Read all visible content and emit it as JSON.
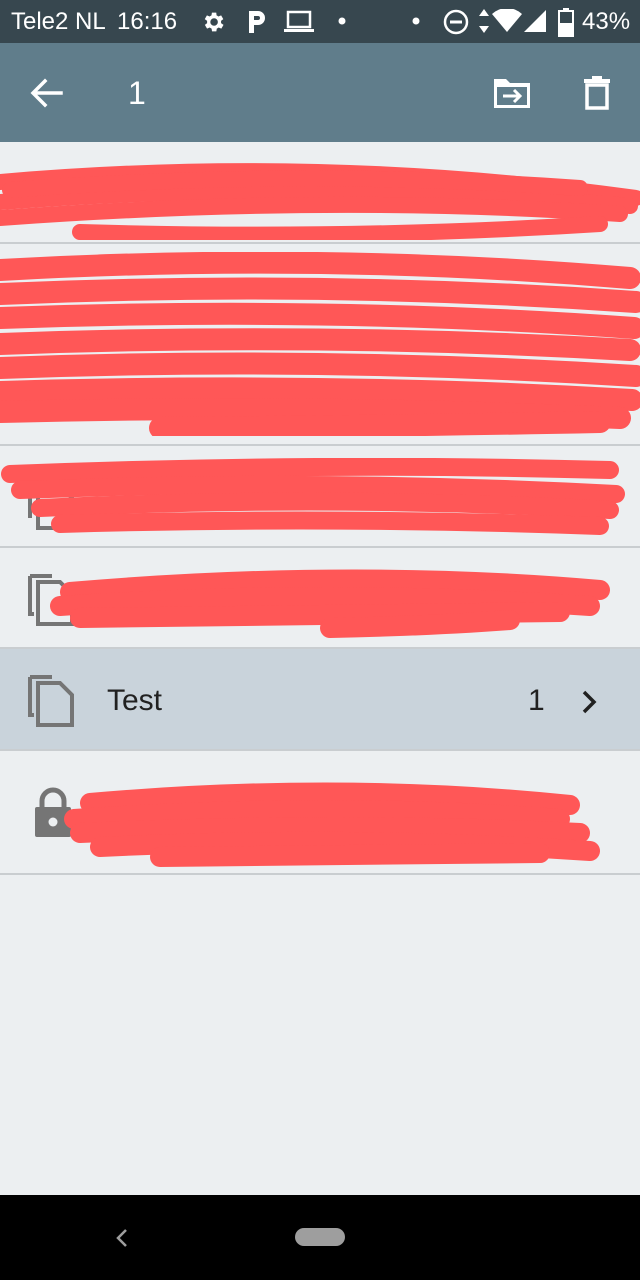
{
  "status_bar": {
    "carrier": "Tele2 NL",
    "time": "16:16",
    "battery": "43%",
    "icons": [
      "gear-icon",
      "parking-icon",
      "laptop-icon",
      "dot-icon",
      "dot-icon",
      "do-not-disturb-icon",
      "data-arrows-icon",
      "wifi-icon",
      "signal-icon",
      "battery-icon"
    ]
  },
  "app_bar": {
    "selected_count": "1",
    "back_icon": "arrow-left-icon",
    "actions": [
      {
        "name": "move-to-folder",
        "icon": "folder-move-icon"
      },
      {
        "name": "delete",
        "icon": "trash-icon"
      }
    ],
    "colors": {
      "background": "#607d8b",
      "status": "#37474f"
    }
  },
  "list": {
    "items": [
      {
        "type": "redacted"
      },
      {
        "type": "redacted"
      },
      {
        "type": "redacted",
        "icon": "copy-document-icon"
      },
      {
        "type": "redacted",
        "icon": "copy-document-icon"
      },
      {
        "type": "folder",
        "icon": "copy-document-icon",
        "title": "Test",
        "count": "1",
        "selected": true,
        "chevron_icon": "chevron-right-icon"
      },
      {
        "type": "redacted",
        "icon": "lock-icon"
      }
    ],
    "redaction_color": "#ff5757",
    "selected_row_color": "#c9d3db"
  },
  "nav_bar": {
    "back_icon": "chevron-left-icon",
    "home_icon": "home-pill-icon"
  }
}
